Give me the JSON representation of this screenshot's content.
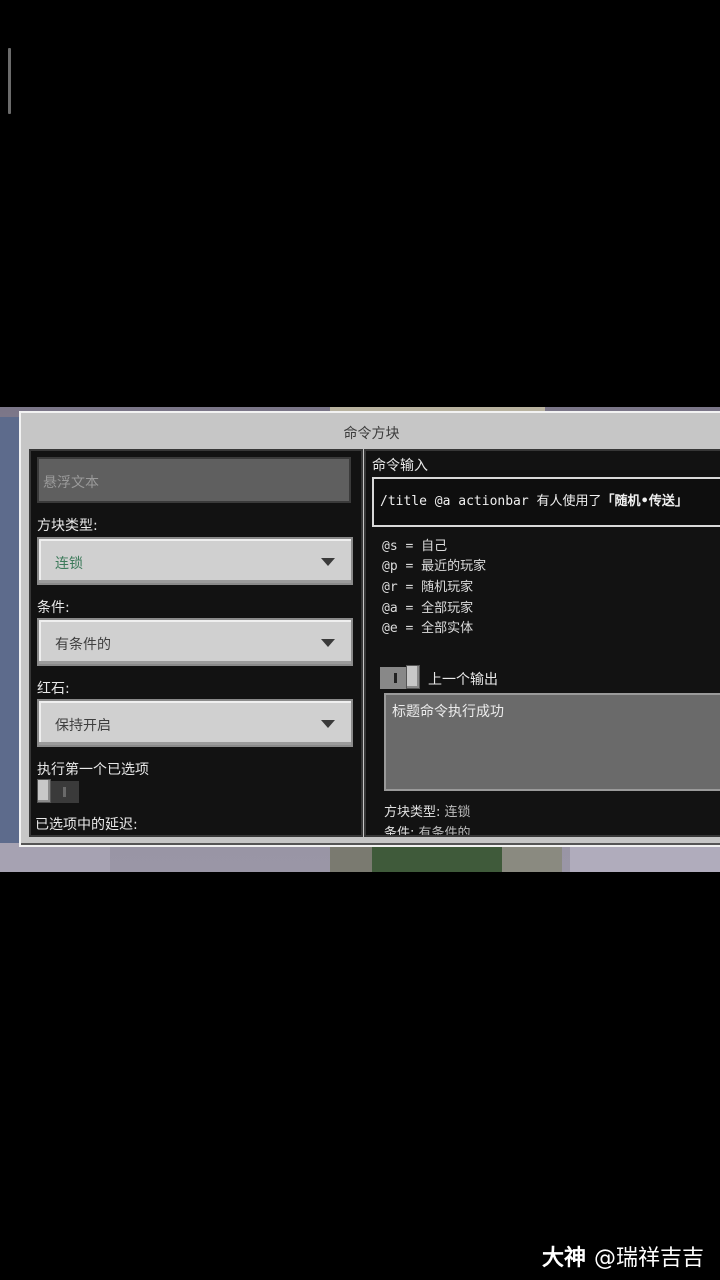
{
  "dialog": {
    "title": "命令方块"
  },
  "left": {
    "hover_text_placeholder": "悬浮文本",
    "block_type_label": "方块类型:",
    "block_type_value": "连锁",
    "condition_label": "条件:",
    "condition_value": "有条件的",
    "redstone_label": "红石:",
    "redstone_value": "保持开启",
    "exec_first_label": "执行第一个已选项",
    "delay_label": "已选项中的延迟:"
  },
  "right": {
    "command_input_label": "命令输入",
    "command_prefix": "/title @a actionbar 有人使用了",
    "command_bold": "「随机•传送」",
    "hints": [
      "@s = 自己",
      "@p = 最近的玩家",
      "@r = 随机玩家",
      "@a = 全部玩家",
      "@e = 全部实体"
    ],
    "previous_output_label": "上一个输出",
    "previous_output_value": "标题命令执行成功",
    "info_block_type_label": "方块类型:",
    "info_block_type_value": "连锁",
    "info_condition_label": "条件:",
    "info_condition_value": "有条件的"
  },
  "watermark": {
    "brand": "大神",
    "user": "@瑞祥吉吉"
  }
}
